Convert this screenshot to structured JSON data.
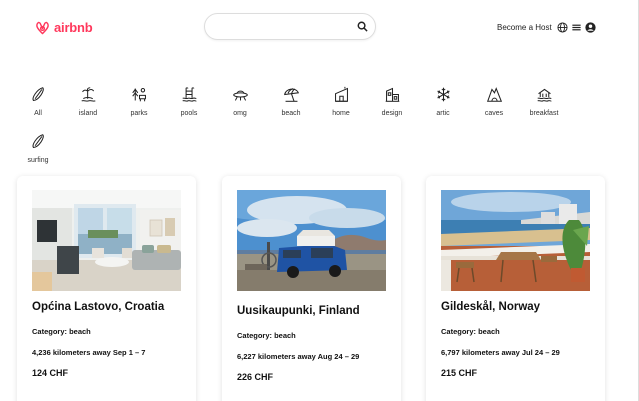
{
  "brand": {
    "name": "airbnb",
    "color": "#FF385C"
  },
  "search": {
    "value": "",
    "placeholder": "",
    "icon": "search-icon"
  },
  "nav": {
    "host_label": "Become a Host",
    "globe_icon": "globe-icon",
    "menu_icon": "menu-icon",
    "user_icon": "user-circle-icon"
  },
  "categories": [
    {
      "label": "All",
      "icon": "surfboard-icon"
    },
    {
      "label": "island",
      "icon": "island-icon"
    },
    {
      "label": "parks",
      "icon": "park-icon"
    },
    {
      "label": "pools",
      "icon": "pool-icon"
    },
    {
      "label": "omg",
      "icon": "ufo-icon"
    },
    {
      "label": "beach",
      "icon": "umbrella-icon"
    },
    {
      "label": "home",
      "icon": "home-icon"
    },
    {
      "label": "design",
      "icon": "design-icon"
    },
    {
      "label": "artic",
      "icon": "snowflake-icon"
    },
    {
      "label": "caves",
      "icon": "cave-icon"
    },
    {
      "label": "breakfast",
      "icon": "breakfast-icon"
    },
    {
      "label": "surfing",
      "icon": "surfboard-icon"
    }
  ],
  "listings": [
    {
      "title": "Općina Lastovo, Croatia",
      "category": "Category: beach",
      "distance": "4,236 kilometers away Sep 1 – 7",
      "price": "124 CHF"
    },
    {
      "title": "Uusikaupunki, Finland",
      "category": "Category: beach",
      "distance": "6,227 kilometers away Aug 24 – 29",
      "price": "226 CHF"
    },
    {
      "title": "Gildeskål, Norway",
      "category": "Category: beach",
      "distance": "6,797 kilometers away Jul 24 – 29",
      "price": "215 CHF"
    }
  ]
}
